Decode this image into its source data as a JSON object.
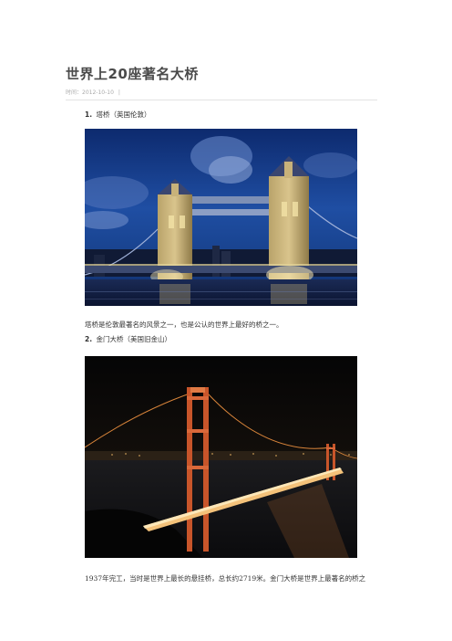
{
  "document": {
    "title": "世界上20座著名大桥",
    "meta": {
      "label": "时间：",
      "date": "2012-10-10",
      "separator": "|"
    }
  },
  "sections": [
    {
      "number": "1.",
      "heading": "塔桥（英国伦敦）",
      "description": "塔桥是伦敦最著名的风景之一，也是公认的世界上最好的桥之一。",
      "photo": "Tower Bridge illuminated at dusk over the River Thames"
    },
    {
      "number": "2.",
      "heading": "金门大桥（美国旧金山）",
      "description": "1937年完工，当时是世界上最长的悬挂桥，总长约2719米。金门大桥是世界上最著名的桥之",
      "photo": "Golden Gate Bridge lit at night"
    }
  ],
  "colors": {
    "title": "#4a4a4a",
    "meta": "#aaaaaa",
    "rule": "#e3e3e3",
    "text": "#333333"
  }
}
